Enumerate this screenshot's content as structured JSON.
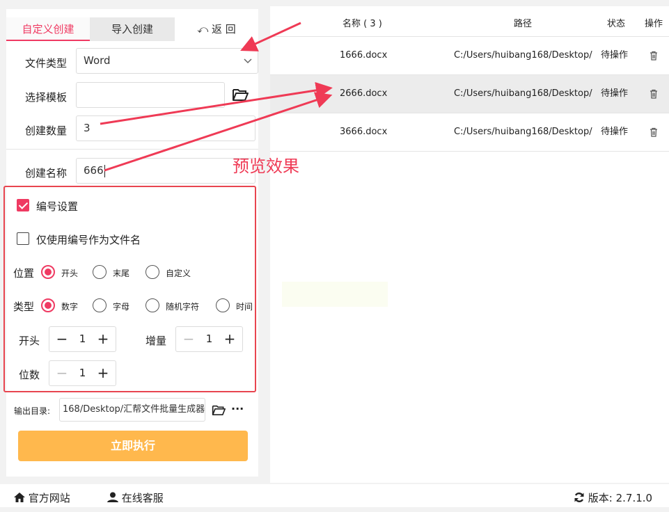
{
  "tabs": {
    "custom": "自定义创建",
    "import": "导入创建",
    "back": "返 回"
  },
  "form": {
    "file_type_label": "文件类型",
    "file_type_value": "Word",
    "template_label": "选择模板",
    "template_value": "",
    "count_label": "创建数量",
    "count_value": "3",
    "name_label": "创建名称",
    "name_value": "666"
  },
  "numbering": {
    "enable_label": "编号设置",
    "enable_checked": true,
    "only_number_label": "仅使用编号作为文件名",
    "only_number_checked": false,
    "position_label": "位置",
    "position_options": [
      "开头",
      "末尾",
      "自定义"
    ],
    "position_selected": "开头",
    "type_label": "类型",
    "type_options": [
      "数字",
      "字母",
      "随机字符",
      "时间"
    ],
    "type_selected": "数字",
    "start_label": "开头",
    "start_value": "1",
    "increment_label": "增量",
    "increment_value": "1",
    "digits_label": "位数",
    "digits_value": "1"
  },
  "output": {
    "label": "输出目录:",
    "path": "168/Desktop/汇帮文件批量生成器",
    "more": "···"
  },
  "execute_label": "立即执行",
  "table": {
    "headers": {
      "name": "名称 ( 3 )",
      "path": "路径",
      "status": "状态",
      "action": "操作"
    },
    "rows": [
      {
        "name": "1666.docx",
        "path": "C:/Users/huibang168/Desktop/",
        "status": "待操作"
      },
      {
        "name": "2666.docx",
        "path": "C:/Users/huibang168/Desktop/",
        "status": "待操作"
      },
      {
        "name": "3666.docx",
        "path": "C:/Users/huibang168/Desktop/",
        "status": "待操作"
      }
    ]
  },
  "annotation": {
    "text": "预览效果",
    "color": "#ef3a55"
  },
  "footer": {
    "website": "官方网站",
    "service": "在线客服",
    "version": "版本: 2.7.1.0"
  },
  "colors": {
    "accent": "#ef3a62",
    "execute": "#ffb84d",
    "box_border": "#e8454f"
  },
  "icons": [
    "chevron-down-icon",
    "folder-open-icon",
    "trash-icon",
    "home-icon",
    "user-icon",
    "refresh-icon",
    "undo-arrow-icon"
  ]
}
